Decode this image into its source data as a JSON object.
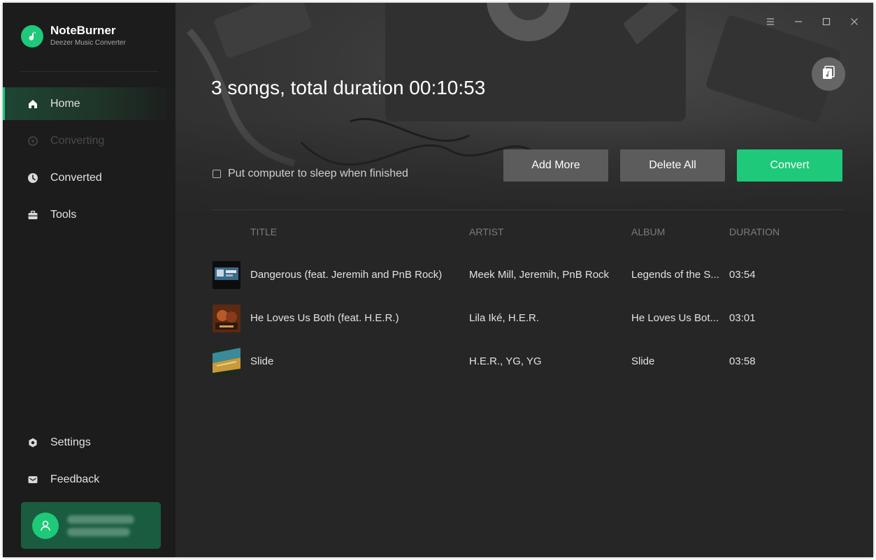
{
  "app": {
    "name": "NoteBurner",
    "subtitle": "Deezer Music Converter"
  },
  "sidebar": {
    "items": [
      {
        "label": "Home",
        "icon": "home-icon",
        "state": "active"
      },
      {
        "label": "Converting",
        "icon": "converting-icon",
        "state": "disabled"
      },
      {
        "label": "Converted",
        "icon": "clock-icon",
        "state": "normal"
      },
      {
        "label": "Tools",
        "icon": "toolbox-icon",
        "state": "normal"
      }
    ],
    "bottom_items": [
      {
        "label": "Settings",
        "icon": "gear-icon"
      },
      {
        "label": "Feedback",
        "icon": "mail-icon"
      }
    ],
    "user": {
      "avatar_icon": "user-icon"
    }
  },
  "window_controls": [
    "menu-icon",
    "minimize-icon",
    "maximize-icon",
    "close-icon"
  ],
  "main": {
    "summary": "3 songs, total duration 00:10:53",
    "sleep_label": "Put computer to sleep when finished",
    "sleep_checked": false,
    "buttons": {
      "add_more": "Add More",
      "delete_all": "Delete All",
      "convert": "Convert"
    },
    "table": {
      "headers": {
        "title": "TITLE",
        "artist": "ARTIST",
        "album": "ALBUM",
        "duration": "DURATION"
      },
      "rows": [
        {
          "title": "Dangerous (feat. Jeremih and PnB Rock)",
          "artist": "Meek Mill, Jeremih, PnB Rock",
          "album": "Legends of the S...",
          "duration": "03:54"
        },
        {
          "title": "He Loves Us Both (feat. H.E.R.)",
          "artist": "Lila Iké, H.E.R.",
          "album": "He Loves Us Bot...",
          "duration": "03:01"
        },
        {
          "title": "Slide",
          "artist": "H.E.R., YG, YG",
          "album": "Slide",
          "duration": "03:58"
        }
      ]
    }
  },
  "colors": {
    "accent": "#1ec97a",
    "sidebar_bg": "#1c1c1c",
    "main_bg": "#262626",
    "secondary_button": "#5c5c5c",
    "user_card": "#1a5c40"
  }
}
